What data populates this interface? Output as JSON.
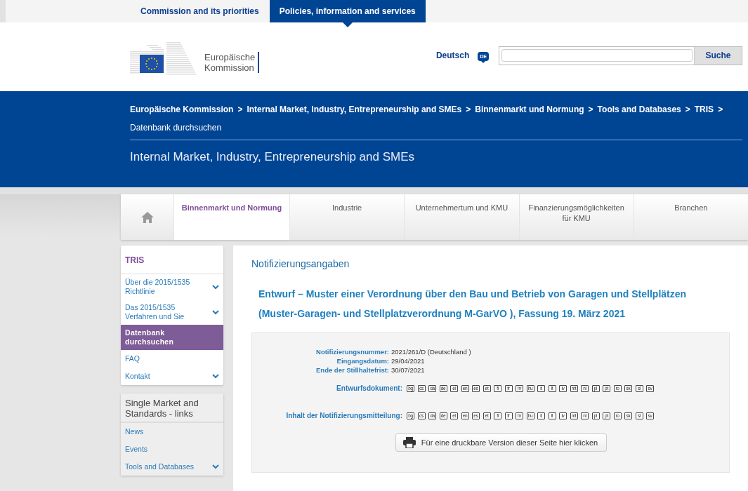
{
  "top_tabs": [
    {
      "label": "Commission and its priorities",
      "selected": false
    },
    {
      "label": "Policies, information and services",
      "selected": true
    }
  ],
  "logo": {
    "line_1": "Europäische",
    "line_2": "Kommission"
  },
  "language": {
    "label": "Deutsch",
    "code": "DE"
  },
  "search": {
    "button": "Suche"
  },
  "breadcrumb": {
    "separator": ">",
    "items": [
      "Europäische Kommission",
      "Internal Market, Industry, Entrepreneurship and SMEs",
      "Binnenmarkt und Normung",
      "Tools and Databases",
      "TRIS",
      "Datenbank durchsuchen"
    ]
  },
  "site_title": "Internal Market, Industry, Entrepreneurship and SMEs",
  "main_menu": [
    {
      "label": "Binnenmarkt und Normung",
      "selected": true
    },
    {
      "label": "Industrie",
      "selected": false
    },
    {
      "label": "Unternehmertum und KMU",
      "selected": false
    },
    {
      "label": "Finanzierungsmöglichkeiten für KMU",
      "selected": false
    },
    {
      "label": "Branchen",
      "selected": false
    }
  ],
  "sidebar": {
    "title": "TRIS",
    "items": [
      {
        "label": "Über die 2015/1535 Richtlinie",
        "selected": false,
        "expandable": true
      },
      {
        "label": "Das 2015/1535 Verfahren und Sie",
        "selected": false,
        "expandable": true
      },
      {
        "label": "Datenbank durchsuchen",
        "selected": true,
        "expandable": false
      },
      {
        "label": "FAQ",
        "selected": false,
        "expandable": false
      },
      {
        "label": "Kontakt",
        "selected": false,
        "expandable": true
      }
    ]
  },
  "links_box": {
    "title": "Single Market and Standards - links",
    "items": [
      {
        "label": "News",
        "expandable": false
      },
      {
        "label": "Events",
        "expandable": false
      },
      {
        "label": "Tools and Databases",
        "expandable": true
      }
    ]
  },
  "main": {
    "heading": "Notifizierungsangaben",
    "title_lines": [
      "Entwurf – Muster einer Verordnung über den Bau und Betrieb von Garagen und Stellplätzen",
      "(Muster-Garagen- und Stellplatzverordnung M-GarVO ), Fassung 19. März 2021"
    ],
    "details": [
      {
        "label": "Notifizierungsnummer:",
        "value": "2021/261/D (Deutschland )"
      },
      {
        "label": "Eingangsdatum:",
        "value": "29/04/2021"
      },
      {
        "label": "Ende der Stillhaltefrist:",
        "value": "30/07/2021"
      }
    ],
    "document_rows": [
      {
        "label": "Entwurfsdokument:",
        "languages": [
          "bg",
          "cs",
          "da",
          "de",
          "el",
          "en",
          "es",
          "et",
          "fi",
          "fr",
          "hr",
          "hu",
          "it",
          "lt",
          "lv",
          "mt",
          "nl",
          "pl",
          "pt",
          "ro",
          "sk",
          "sl",
          "sv"
        ]
      },
      {
        "label": "Inhalt der Notifizierungsmitteilung:",
        "languages": [
          "bg",
          "cs",
          "da",
          "de",
          "el",
          "en",
          "es",
          "et",
          "fi",
          "fr",
          "hr",
          "hu",
          "it",
          "lt",
          "lv",
          "mt",
          "nl",
          "pl",
          "pt",
          "ro",
          "sk",
          "sl",
          "sv"
        ]
      }
    ],
    "print_button": "Für eine druckbare Version dieser Seite hier klicken"
  }
}
